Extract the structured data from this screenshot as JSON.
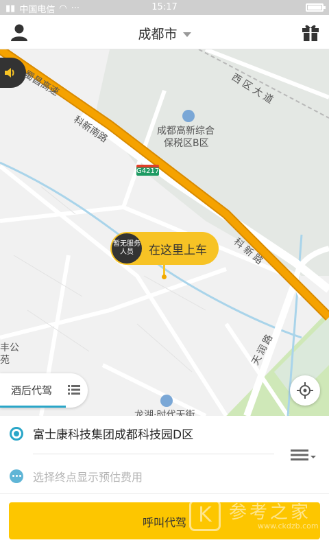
{
  "status_bar": {
    "carrier": "中国电信",
    "time": "15:17",
    "dots": "···"
  },
  "header": {
    "city": "成都市",
    "icons": [
      "user-icon",
      "gift-icon",
      "dropdown-caret-icon"
    ]
  },
  "map": {
    "labels": {
      "road_shuchang": "蜀昌高速",
      "road_kexin_nan": "科新南路",
      "road_xiqu": "西区大道",
      "poi_bonded": "成都高新综合",
      "poi_bonded_2": "保税区B区",
      "shield": "G4217",
      "road_kexin": "科新路",
      "road_tianrun": "天润路",
      "garden_1": "丰公",
      "garden_2": "苑",
      "poi_longhu": "龙湖·时代天街"
    },
    "pickup_badge": "暂无服务人员",
    "pickup_text": "在这里上车",
    "mode_label": "酒后代驾"
  },
  "panel": {
    "origin": "富士康科技集团成都科技园D区",
    "destination_placeholder": "选择终点显示预估费用",
    "call_button": "呼叫代驾"
  },
  "watermark": {
    "logo_letter": "K",
    "text": "参考之家",
    "url": "www.ckdzb.com"
  },
  "colors": {
    "accent_yellow": "#fdc600",
    "accent_blue": "#2aa6c8",
    "highway_orange": "#f5a200"
  }
}
